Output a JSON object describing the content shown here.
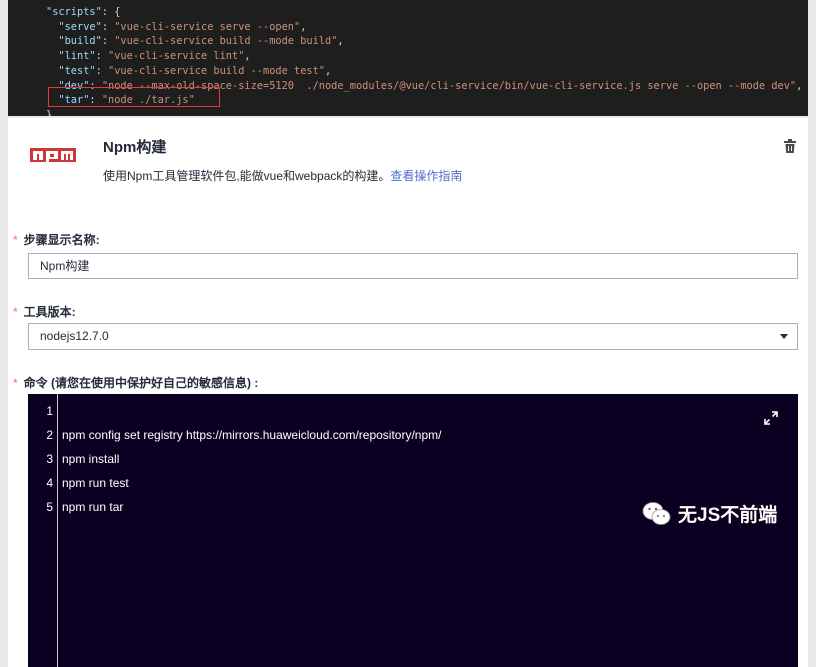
{
  "code_snippet": {
    "lines": [
      {
        "indent": "",
        "key": "\"scripts\"",
        "value": "{",
        "is_obj": true
      },
      {
        "indent": "  ",
        "key": "\"serve\"",
        "value": "\"vue-cli-service serve --open\"",
        "tail": ","
      },
      {
        "indent": "  ",
        "key": "\"build\"",
        "value": "\"vue-cli-service build --mode build\"",
        "tail": ","
      },
      {
        "indent": "  ",
        "key": "\"lint\"",
        "value": "\"vue-cli-service lint\"",
        "tail": ","
      },
      {
        "indent": "  ",
        "key": "\"test\"",
        "value": "\"vue-cli-service build --mode test\"",
        "tail": ","
      },
      {
        "indent": "  ",
        "key": "\"dev\"",
        "value": "\"node --max-old-space-size=5120  ./node_modules/@vue/cli-service/bin/vue-cli-service.js serve --open --mode dev\"",
        "tail": ","
      },
      {
        "indent": "  ",
        "key": "\"tar\"",
        "value": "\"node ./tar.js\"",
        "tail": ""
      },
      {
        "indent": "",
        "key": "",
        "value": "}",
        "tail": ""
      }
    ]
  },
  "step": {
    "logo_text": "npm",
    "title": "Npm构建",
    "description": "使用Npm工具管理软件包,能做vue和webpack的构建。",
    "guide_link": "查看操作指南",
    "delete_icon": "trash-icon"
  },
  "form": {
    "required_mark": "*",
    "name_label": "步骤显示名称:",
    "name_value": "Npm构建",
    "version_label": "工具版本:",
    "version_value": "nodejs12.7.0",
    "command_label": "命令 (请您在使用中保护好自己的敏感信息) :"
  },
  "editor": {
    "lines": [
      {
        "n": "1",
        "text": ""
      },
      {
        "n": "2",
        "text": "npm config set registry https://mirrors.huaweicloud.com/repository/npm/"
      },
      {
        "n": "3",
        "text": "npm install"
      },
      {
        "n": "4",
        "text": "npm run test"
      },
      {
        "n": "5",
        "text": "npm run tar"
      }
    ],
    "expand_icon": "expand-icon",
    "background": "#0c0022"
  },
  "watermark": {
    "text": "无JS不前端",
    "icon": "wechat-icon"
  },
  "colors": {
    "link": "#526ecc",
    "required": "#f66f6a",
    "npm_red": "#cb3837",
    "highlight_box": "#e53935"
  }
}
